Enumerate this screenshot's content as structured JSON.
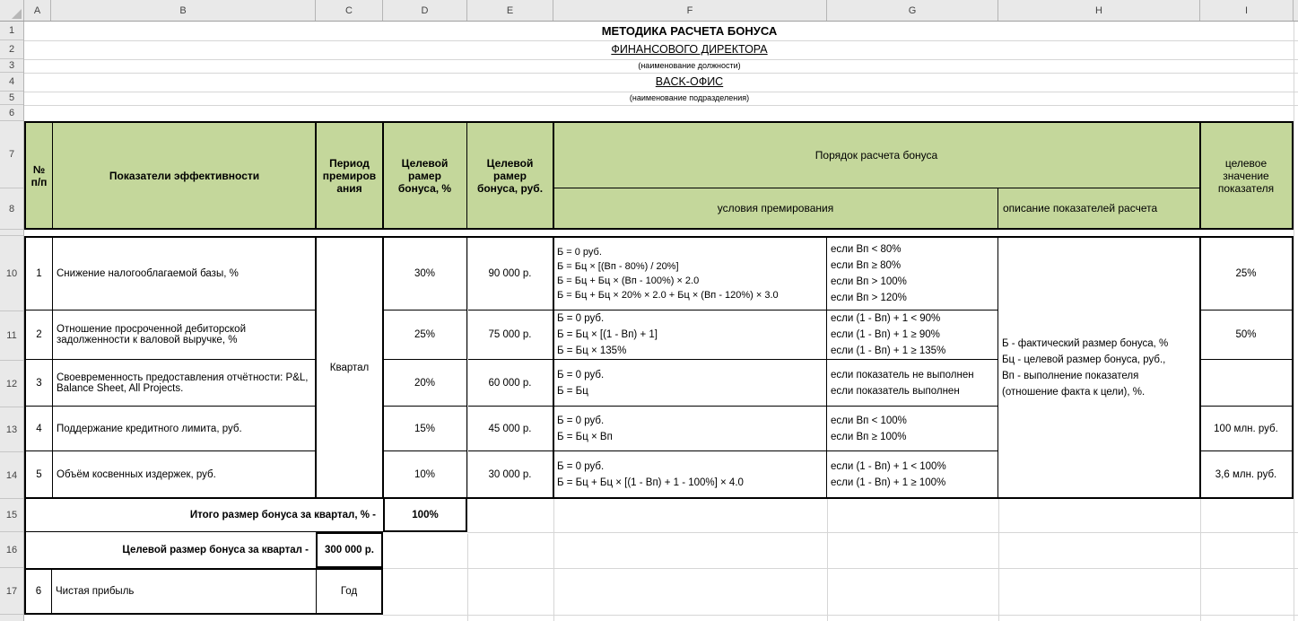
{
  "sheet": {
    "col_headers": [
      "A",
      "B",
      "C",
      "D",
      "E",
      "F",
      "G",
      "H",
      "I"
    ],
    "row_numbers": [
      "1",
      "2",
      "3",
      "4",
      "5",
      "6",
      "7",
      "8",
      "10",
      "11",
      "12",
      "13",
      "14",
      "15",
      "16",
      "17"
    ]
  },
  "title": {
    "line1": "МЕТОДИКА РАСЧЕТА БОНУСА",
    "line2": "ФИНАНСОВОГО ДИРЕКТОРА",
    "line3": "(наименование должности)",
    "line4": "BACK-ОФИС",
    "line5": "(наименование подразделения)"
  },
  "table": {
    "headers": {
      "num": "№ п/п",
      "indicators": "Показатели эффективности",
      "period": "Период премирования",
      "target_pct": "Целевой рамер бонуса, %",
      "target_rub": "Целевой рамер бонуса, руб.",
      "order": "Порядок расчета бонуса",
      "conditions": "условия премирования",
      "description": "описание показателей расчета",
      "target_value": "целевое значение показателя"
    },
    "period_merged": "Квартал",
    "description_merged": "Б - фактический размер бонуса, %\nБц - целевой размер бонуса, руб.,\nВп - выполнение показателя\n(отношение факта к цели), %.",
    "rows": [
      {
        "num": "1",
        "indicator": "Снижение налогооблагаемой базы, %",
        "pct": "30%",
        "rub": "90 000 р.",
        "formulas": "Б = 0 руб.\nБ = Бц × [(Вп - 80%) / 20%]\nБ = Бц + Бц × (Вп - 100%) × 2.0\nБ = Бц + Бц × 20% × 2.0 + Бц × (Вп - 120%) × 3.0",
        "conditions": "если Вп < 80%\nесли Вп ≥ 80%\nесли Вп > 100%\nесли Вп > 120%",
        "target": "25%"
      },
      {
        "num": "2",
        "indicator": "Отношение просроченной дебиторской задолженности к валовой выручке, %",
        "pct": "25%",
        "rub": "75 000 р.",
        "formulas": "Б = 0 руб.\nБ = Бц × [(1 - Вп) + 1]\nБ = Бц × 135%",
        "conditions": "если (1 - Вп) + 1 < 90%\nесли (1 - Вп) + 1 ≥ 90%\nесли (1 - Вп) + 1 ≥ 135%",
        "target": "50%"
      },
      {
        "num": "3",
        "indicator": "Своевременность предоставления отчётности: P&L, Balance Sheet, All Projects.",
        "pct": "20%",
        "rub": "60 000 р.",
        "formulas": "Б = 0 руб.\nБ = Бц",
        "conditions": "если показатель не выполнен\nесли показатель выполнен",
        "target": ""
      },
      {
        "num": "4",
        "indicator": "Поддержание кредитного лимита, руб.",
        "pct": "15%",
        "rub": "45 000 р.",
        "formulas": "Б = 0 руб.\nБ = Бц × Вп",
        "conditions": "если Вп < 100%\nесли Вп ≥ 100%",
        "target": "100 млн. руб."
      },
      {
        "num": "5",
        "indicator": "Объём косвенных издержек, руб.",
        "pct": "10%",
        "rub": "30 000 р.",
        "formulas": "Б = 0 руб.\nБ = Бц + Бц × [(1 - Вп) + 1 - 100%] × 4.0",
        "conditions": "если (1 - Вп) + 1 < 100%\nесли (1 - Вп) + 1 ≥ 100%",
        "target": "3,6 млн. руб."
      }
    ]
  },
  "totals": {
    "quarter_pct_label": "Итого размер бонуса за квартал, % -",
    "quarter_pct_value": "100%",
    "quarter_rub_label": "Целевой размер бонуса за квартал -",
    "quarter_rub_value": "300 000 р."
  },
  "extra_row": {
    "num": "6",
    "indicator": "Чистая прибыль",
    "period": "Год"
  },
  "colors": {
    "header_fill": "#c4d79b",
    "grid": "#d6d6d6"
  }
}
